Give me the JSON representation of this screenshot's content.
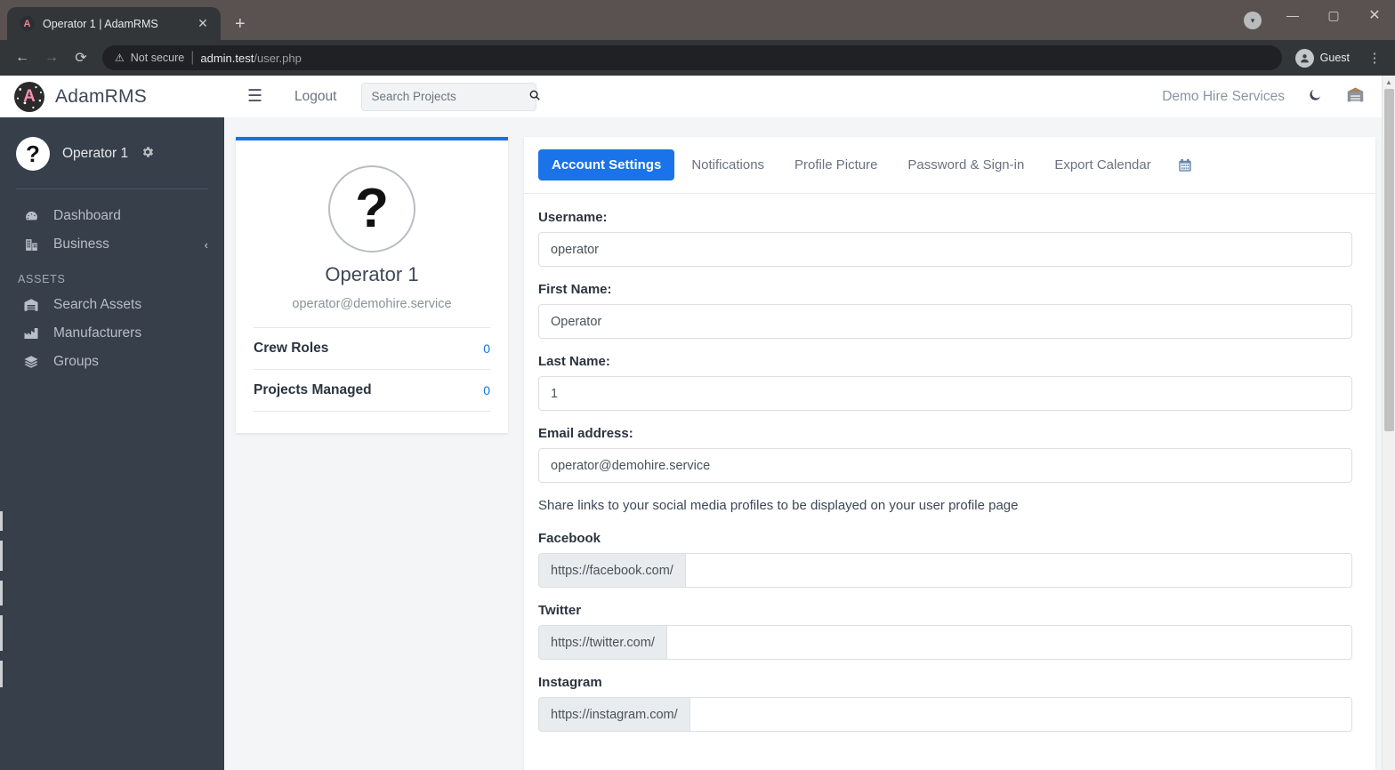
{
  "browser": {
    "tab": {
      "title": "Operator 1 | AdamRMS",
      "favicon_letter": "A",
      "close_icon": "close-icon"
    },
    "new_tab_label": "+",
    "window_controls": {
      "minimize": "—",
      "maximize": "▢",
      "close": "✕"
    },
    "nav": {
      "back": "←",
      "forward": "→",
      "reload": "⟳"
    },
    "omnibox": {
      "security_label": "Not secure",
      "url_host": "admin.test",
      "url_path": "/user.php"
    },
    "profile_label": "Guest",
    "menu_icon": "kebab-menu-icon"
  },
  "sidebar": {
    "brand": {
      "name": "AdamRMS",
      "logo_letter": "A"
    },
    "user": {
      "name": "Operator 1",
      "avatar_glyph": "?",
      "settings_icon": "gear-icon"
    },
    "nav_items": [
      {
        "label": "Dashboard",
        "icon": "dashboard-gauge-icon"
      },
      {
        "label": "Business",
        "icon": "building-icon",
        "chevron": "‹"
      }
    ],
    "section_title": "ASSETS",
    "asset_items": [
      {
        "label": "Search Assets",
        "icon": "warehouse-icon"
      },
      {
        "label": "Manufacturers",
        "icon": "factory-icon"
      },
      {
        "label": "Groups",
        "icon": "layers-icon"
      }
    ]
  },
  "topnav": {
    "menu_icon": "hamburger-icon",
    "logout_label": "Logout",
    "search": {
      "placeholder": "Search Projects",
      "value": "",
      "icon": "search-icon"
    },
    "org_name": "Demo Hire Services",
    "dark_mode_icon": "moon-icon",
    "warehouse_icon": "warehouse-icon"
  },
  "profile_card": {
    "avatar_glyph": "?",
    "name": "Operator 1",
    "email": "operator@demohire.service",
    "stats": [
      {
        "label": "Crew Roles",
        "value": "0"
      },
      {
        "label": "Projects Managed",
        "value": "0"
      }
    ]
  },
  "main": {
    "tabs": [
      {
        "label": "Account Settings",
        "active": true
      },
      {
        "label": "Notifications",
        "active": false
      },
      {
        "label": "Profile Picture",
        "active": false
      },
      {
        "label": "Password & Sign-in",
        "active": false
      },
      {
        "label": "Export Calendar",
        "active": false
      }
    ],
    "calendar_icon": "calendar-icon",
    "fields": [
      {
        "label": "Username:",
        "value": "operator"
      },
      {
        "label": "First Name:",
        "value": "Operator"
      },
      {
        "label": "Last Name:",
        "value": "1"
      },
      {
        "label": "Email address:",
        "value": "operator@demohire.service"
      }
    ],
    "social_helper": "Share links to your social media profiles to be displayed on your user profile page",
    "social": [
      {
        "label": "Facebook",
        "prefix": "https://facebook.com/",
        "value": ""
      },
      {
        "label": "Twitter",
        "prefix": "https://twitter.com/",
        "value": ""
      },
      {
        "label": "Instagram",
        "prefix": "https://instagram.com/",
        "value": ""
      }
    ]
  },
  "colors": {
    "accent_blue": "#1a73e8",
    "card_top_border": "#1374e8",
    "sidebar_bg": "#363f4a",
    "page_bg": "#f4f5f7",
    "brand_pink": "#f48fb1"
  }
}
